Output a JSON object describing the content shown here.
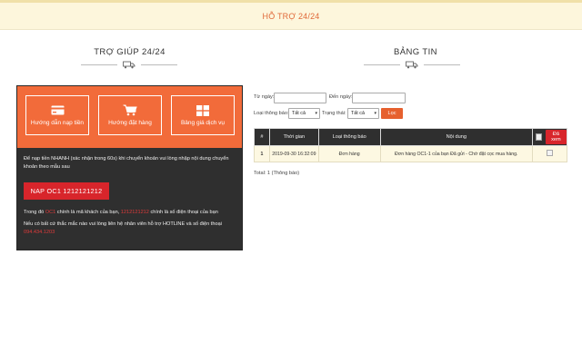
{
  "topbar": {
    "title": "HỖ TRỢ 24/24"
  },
  "help": {
    "section_title": "TRỢ GIÚP 24/24",
    "buttons": [
      {
        "label": "Hướng dẫn nạp tiền",
        "icon": "credit-card-icon"
      },
      {
        "label": "Hướng đặt hàng",
        "icon": "shopping-cart-icon"
      },
      {
        "label": "Bảng giá dịch vụ",
        "icon": "table-grid-icon"
      }
    ],
    "intro": "Để nạp tiền NHANH (xác nhận trong 60s) khi chuyển khoản vui lòng nhập nội dung chuyển khoản theo mẫu sau",
    "deposit_code": "NAP OC1 1212121212",
    "in_which": {
      "prefix": "Trong đó ",
      "code": "OC1",
      "middle": " chính là mã khách của bạn, ",
      "phone": "1212121212",
      "suffix": " chính là số điện thoại của bạn"
    },
    "contact_text": "Nếu có bất cứ thắc mắc nào vui lòng liên hệ nhân viên hỗ trợ HOTLINE và số điện thoại",
    "hotline": "094.434.1203"
  },
  "news": {
    "section_title": "BẢNG TIN",
    "filters": {
      "from_label": "Từ ngày:",
      "to_label": "Đến ngày:",
      "type_label": "Loại thông báo:",
      "type_value": "Tất cả",
      "status_label": "Trạng thái:",
      "status_value": "Tất cả",
      "filter_button": "Lọc"
    },
    "table": {
      "headers": [
        "#",
        "Thời gian",
        "Loại thông báo",
        "Nội dung"
      ],
      "delete_button": "Đã xem",
      "rows": [
        {
          "num": "1",
          "time": "2019-09-30 16:32:09",
          "type": "Đơn hàng",
          "content": "Đơn hàng OC1-1 của bạn Đã gửi - Chờ đặt cọc mua hàng."
        }
      ]
    },
    "total": "Total: 1 (Thông báo)"
  },
  "colors": {
    "accent": "#f26b3a",
    "dark_panel": "#2f2f2f",
    "red": "#d8252b",
    "topbar_bg": "#fdf6dc"
  }
}
